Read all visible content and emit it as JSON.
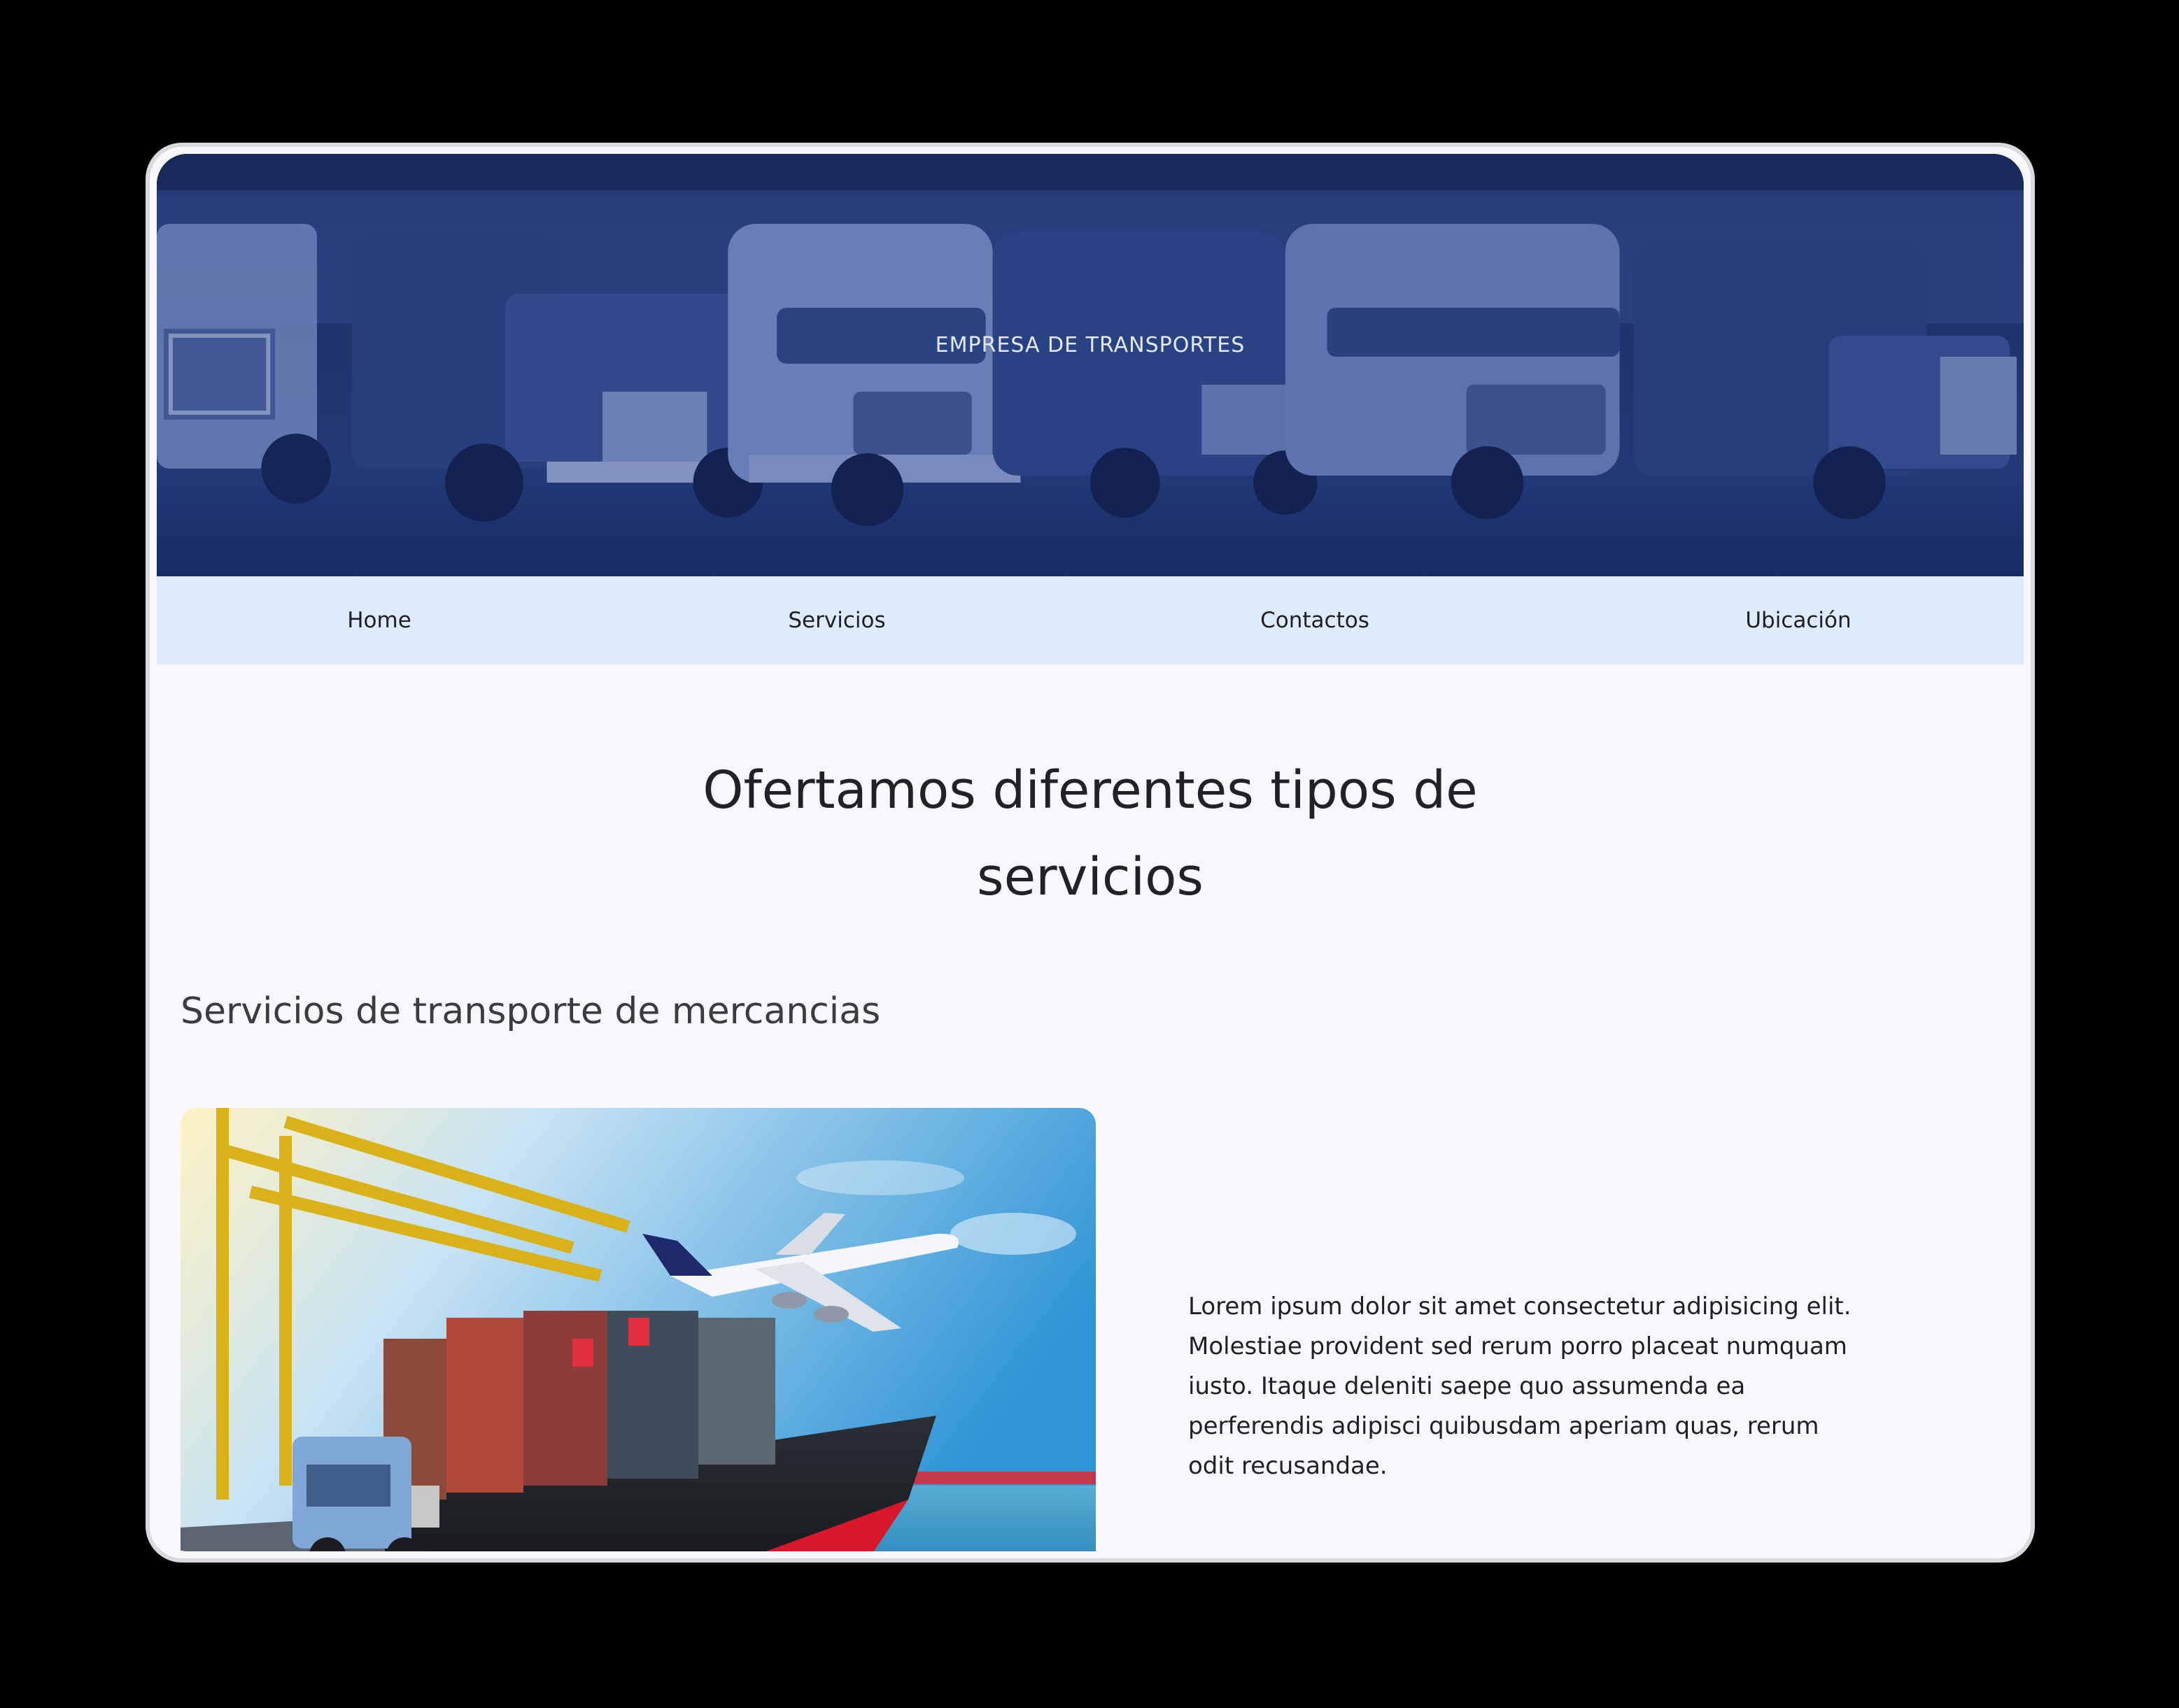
{
  "hero": {
    "title": "EMPRESA DE TRANSPORTES",
    "background_image": "trucks-parked-in-row",
    "overlay_color": "#1c3270"
  },
  "nav": {
    "background_color": "#deebfc",
    "items": [
      {
        "label": "Home"
      },
      {
        "label": "Servicios"
      },
      {
        "label": "Contactos"
      },
      {
        "label": "Ubicación"
      }
    ]
  },
  "main": {
    "heading_line1": "Ofertamos diferentes tipos de",
    "heading_line2": "servicios",
    "section_title": "Servicios de transporte de mercancias",
    "section_image": "cargo-ship-plane-truck-port",
    "section_text": "Lorem ipsum dolor sit amet consectetur adipisicing elit. Molestiae provident sed rerum porro placeat numquam iusto. Itaque deleniti saepe quo assumenda ea perferendis adipisci quibusdam aperiam quas, rerum odit recusandae."
  }
}
